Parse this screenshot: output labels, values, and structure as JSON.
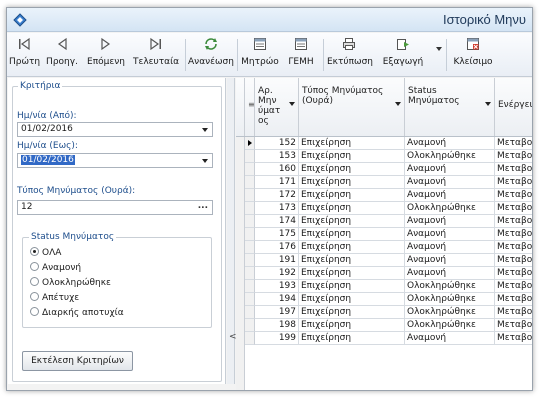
{
  "window": {
    "title": "Ιστορικό Μηνυ"
  },
  "toolbar": {
    "first_label": "Πρώτη",
    "prev_label": "Προηγ.",
    "next_label": "Επόμενη",
    "last_label": "Τελευταία",
    "refresh_label": "Ανανέωση",
    "registry_label": "Μητρώο",
    "gemi_label": "ΓΕΜΗ",
    "print_label": "Εκτύπωση",
    "export_label": "Εξαγωγή",
    "close_label": "Κλείσιμο"
  },
  "criteria": {
    "group_label": "Κριτήρια",
    "date_from_label": "Ημ/νία (Από):",
    "date_from_value": "01/02/2016",
    "date_to_label": "Ημ/νία (Εως):",
    "date_to_value": "01/02/2016",
    "type_label": "Τύπος Μηνύματος (Ουρά):",
    "type_value": "12",
    "ellipsis": "...",
    "status_label": "Status Μηνύματος",
    "status_options": [
      "ΟΛΑ",
      "Αναμονή",
      "Ολοκληρώθηκε",
      "Απέτυχε",
      "Διαρκής αποτυχία"
    ],
    "status_selected": "ΟΛΑ",
    "run_label": "Εκτέλεση Κριτηρίων"
  },
  "grid": {
    "columns": [
      "Αρ. Μην ύματ ος",
      "Τύπος Μηνύματος (Ουρά)",
      "Status Μηνύματος",
      "Ενέργεια"
    ],
    "rows": [
      [
        "152",
        "Επιχείρηση",
        "Αναμονή",
        "Μεταβολ"
      ],
      [
        "153",
        "Επιχείρηση",
        "Ολοκληρώθηκε",
        "Μεταβολ"
      ],
      [
        "160",
        "Επιχείρηση",
        "Αναμονή",
        "Μεταβολ"
      ],
      [
        "171",
        "Επιχείρηση",
        "Αναμονή",
        "Μεταβολ"
      ],
      [
        "172",
        "Επιχείρηση",
        "Αναμονή",
        "Μεταβολ"
      ],
      [
        "173",
        "Επιχείρηση",
        "Ολοκληρώθηκε",
        "Μεταβολ"
      ],
      [
        "174",
        "Επιχείρηση",
        "Αναμονή",
        "Μεταβολ"
      ],
      [
        "175",
        "Επιχείρηση",
        "Αναμονή",
        "Μεταβολ"
      ],
      [
        "176",
        "Επιχείρηση",
        "Αναμονή",
        "Μεταβολ"
      ],
      [
        "191",
        "Επιχείρηση",
        "Αναμονή",
        "Μεταβολ"
      ],
      [
        "192",
        "Επιχείρηση",
        "Αναμονή",
        "Μεταβολ"
      ],
      [
        "193",
        "Επιχείρηση",
        "Ολοκληρώθηκε",
        "Μεταβολ"
      ],
      [
        "194",
        "Επιχείρηση",
        "Ολοκληρώθηκε",
        "Μεταβολ"
      ],
      [
        "197",
        "Επιχείρηση",
        "Ολοκληρώθηκε",
        "Μεταβολ"
      ],
      [
        "198",
        "Επιχείρηση",
        "Ολοκληρώθηκε",
        "Μεταβολ"
      ],
      [
        "199",
        "Επιχείρηση",
        "Αναμονή",
        "Μεταβολ"
      ]
    ]
  },
  "colors": {
    "selection": "#3169c6",
    "label_blue": "#1e4e8c",
    "title_text": "#203a5a"
  },
  "icons": [
    "app-diamond-icon",
    "first-record-icon",
    "prev-record-icon",
    "next-record-icon",
    "last-record-icon",
    "refresh-icon",
    "registry-icon",
    "gemi-icon",
    "print-icon",
    "export-icon",
    "close-window-icon"
  ]
}
